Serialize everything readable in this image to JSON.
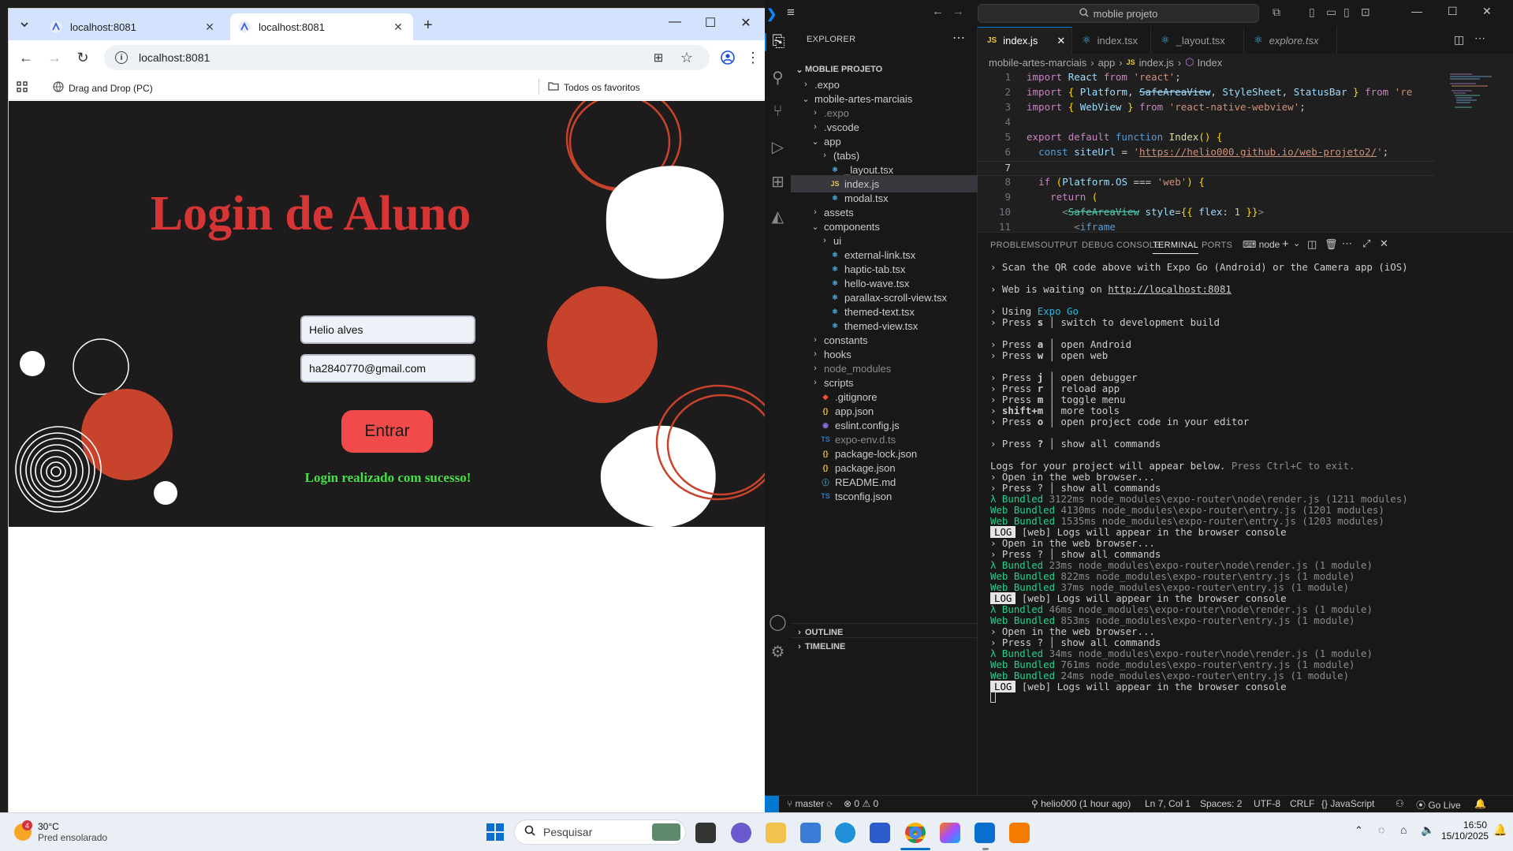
{
  "chrome": {
    "tabs": [
      {
        "title": "localhost:8081",
        "active": false
      },
      {
        "title": "localhost:8081",
        "active": true
      }
    ],
    "url": "localhost:8081",
    "bookmarks": {
      "item": "Drag and Drop (PC)",
      "all": "Todos os favoritos"
    }
  },
  "app": {
    "title": "Login de Aluno",
    "name_value": "Helio alves",
    "email_value": "ha2840770@gmail.com",
    "button": "Entrar",
    "message": "Login realizado com sucesso!",
    "colors": {
      "background": "#1e1b1c",
      "accent": "#c8432b",
      "title": "#d63535",
      "success": "#45e045"
    }
  },
  "vscode": {
    "search": "moblie projeto",
    "explorer_label": "EXPLORER",
    "project": "MOBLIE PROJETO",
    "tree": [
      {
        "label": ".expo",
        "kind": "folder",
        "open": false,
        "indent": 1
      },
      {
        "label": "mobile-artes-marciais",
        "kind": "folder",
        "open": true,
        "indent": 1
      },
      {
        "label": ".expo",
        "kind": "folder",
        "open": false,
        "indent": 2,
        "dim": true
      },
      {
        "label": ".vscode",
        "kind": "folder",
        "open": false,
        "indent": 2
      },
      {
        "label": "app",
        "kind": "folder",
        "open": true,
        "indent": 2
      },
      {
        "label": "(tabs)",
        "kind": "folder",
        "open": false,
        "indent": 3
      },
      {
        "label": "_layout.tsx",
        "kind": "tsx",
        "indent": 3
      },
      {
        "label": "index.js",
        "kind": "js",
        "indent": 3,
        "selected": true
      },
      {
        "label": "modal.tsx",
        "kind": "tsx",
        "indent": 3
      },
      {
        "label": "assets",
        "kind": "folder",
        "open": false,
        "indent": 2
      },
      {
        "label": "components",
        "kind": "folder",
        "open": true,
        "indent": 2
      },
      {
        "label": "ui",
        "kind": "folder",
        "open": false,
        "indent": 3
      },
      {
        "label": "external-link.tsx",
        "kind": "tsx",
        "indent": 3
      },
      {
        "label": "haptic-tab.tsx",
        "kind": "tsx",
        "indent": 3
      },
      {
        "label": "hello-wave.tsx",
        "kind": "tsx",
        "indent": 3
      },
      {
        "label": "parallax-scroll-view.tsx",
        "kind": "tsx",
        "indent": 3
      },
      {
        "label": "themed-text.tsx",
        "kind": "tsx",
        "indent": 3
      },
      {
        "label": "themed-view.tsx",
        "kind": "tsx",
        "indent": 3
      },
      {
        "label": "constants",
        "kind": "folder",
        "open": false,
        "indent": 2
      },
      {
        "label": "hooks",
        "kind": "folder",
        "open": false,
        "indent": 2
      },
      {
        "label": "node_modules",
        "kind": "folder",
        "open": false,
        "indent": 2,
        "dim": true
      },
      {
        "label": "scripts",
        "kind": "folder",
        "open": false,
        "indent": 2
      },
      {
        "label": ".gitignore",
        "kind": "git",
        "indent": 2
      },
      {
        "label": "app.json",
        "kind": "json",
        "indent": 2
      },
      {
        "label": "eslint.config.js",
        "kind": "eslint",
        "indent": 2
      },
      {
        "label": "expo-env.d.ts",
        "kind": "ts",
        "indent": 2,
        "dim": true
      },
      {
        "label": "package-lock.json",
        "kind": "json",
        "indent": 2
      },
      {
        "label": "package.json",
        "kind": "json",
        "indent": 2
      },
      {
        "label": "README.md",
        "kind": "info",
        "indent": 2
      },
      {
        "label": "tsconfig.json",
        "kind": "tsconfig",
        "indent": 2
      }
    ],
    "outline": "OUTLINE",
    "timeline": "TIMELINE",
    "editor_tabs": [
      {
        "label": "index.js",
        "icon": "JS",
        "active": true
      },
      {
        "label": "index.tsx",
        "icon": "⚛",
        "active": false
      },
      {
        "label": "_layout.tsx",
        "icon": "⚛",
        "active": false
      },
      {
        "label": "explore.tsx",
        "icon": "⚛",
        "active": false
      }
    ],
    "breadcrumb": [
      "mobile-artes-marciais",
      "app",
      "index.js",
      "Index"
    ],
    "panel_tabs": [
      "PROBLEMS",
      "OUTPUT",
      "DEBUG CONSOLE",
      "TERMINAL",
      "PORTS"
    ],
    "terminal_shell": "node",
    "status": {
      "branch": "master",
      "problems": "0",
      "warnings": "0",
      "blame": "helio000 (1 hour ago)",
      "position": "Ln 7, Col 1",
      "spaces": "Spaces: 2",
      "encoding": "UTF-8",
      "eol": "CRLF",
      "language": "JavaScript",
      "golive": "Go Live"
    }
  },
  "taskbar": {
    "weather_temp": "30°C",
    "weather_desc": "Pred ensolarado",
    "weather_badge": "4",
    "search": "Pesquisar",
    "time": "16:50",
    "date": "15/10/2025"
  }
}
